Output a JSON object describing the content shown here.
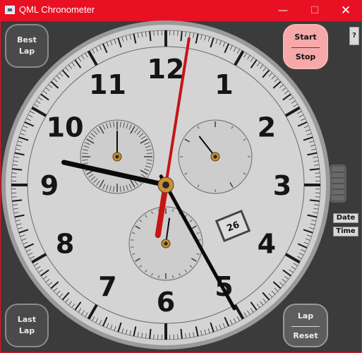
{
  "window": {
    "title": "QML Chronometer",
    "controls": {
      "minimize": "—",
      "maximize": "☐",
      "close": "✕"
    }
  },
  "buttons": {
    "best_lap": [
      "Best",
      "Lap"
    ],
    "last_lap": [
      "Last",
      "Lap"
    ],
    "start": "Start",
    "stop": "Stop",
    "lap": "Lap",
    "reset": "Reset",
    "help": "?",
    "date": "Date",
    "time": "Time"
  },
  "dial": {
    "hour_numerals": [
      "12",
      "1",
      "2",
      "3",
      "4",
      "5",
      "6",
      "7",
      "8",
      "9",
      "10",
      "11"
    ],
    "date_window": "26",
    "time": {
      "hour": 9,
      "minute": 25,
      "second_hand_second": 1.5
    },
    "colors": {
      "face": "#d2d2d2",
      "bezel": "#b0b0b0",
      "second_hand": "#c81414",
      "hands": "#0a0a0a",
      "pivot": "#c8903a",
      "title_bar": "#e81123"
    }
  }
}
